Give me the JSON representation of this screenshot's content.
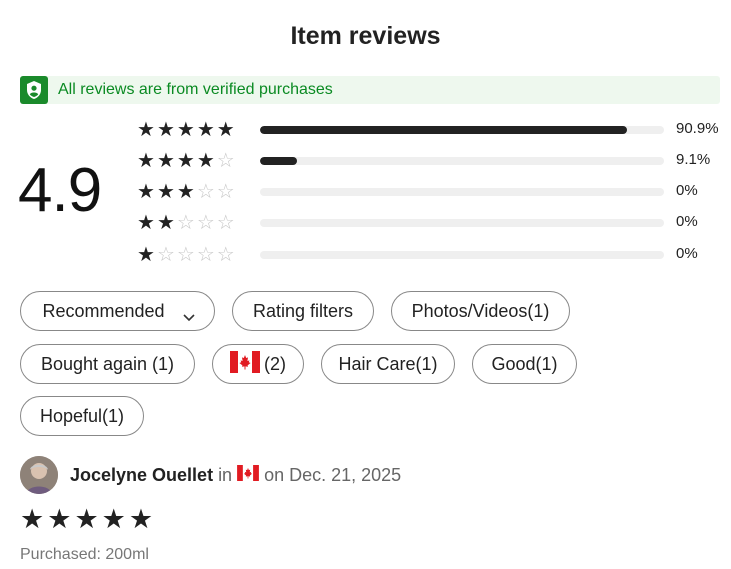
{
  "page": {
    "title": "Item reviews"
  },
  "verified": {
    "text": "All reviews are from verified purchases",
    "icon": "shield-user-icon",
    "color": "#1a8a2b"
  },
  "summary": {
    "average": "4.9",
    "distribution": [
      {
        "stars": 5,
        "percent": "90.9%",
        "fraction": 0.909
      },
      {
        "stars": 4,
        "percent": "9.1%",
        "fraction": 0.091
      },
      {
        "stars": 3,
        "percent": "0%",
        "fraction": 0
      },
      {
        "stars": 2,
        "percent": "0%",
        "fraction": 0
      },
      {
        "stars": 1,
        "percent": "0%",
        "fraction": 0
      }
    ]
  },
  "filters": {
    "sort": "Recommended",
    "rating_filters": "Rating filters",
    "photos_videos": "Photos/Videos(1)",
    "bought_again": "Bought again (1)",
    "country_count": "(2)",
    "hair_care": "Hair Care(1)",
    "good": "Good(1)",
    "hopeful": "Hopeful(1)"
  },
  "review": {
    "name": "Jocelyne Ouellet",
    "in_text": "in",
    "date_text": "on Dec. 21, 2025",
    "rating": 5,
    "purchased": "Purchased: 200ml"
  }
}
